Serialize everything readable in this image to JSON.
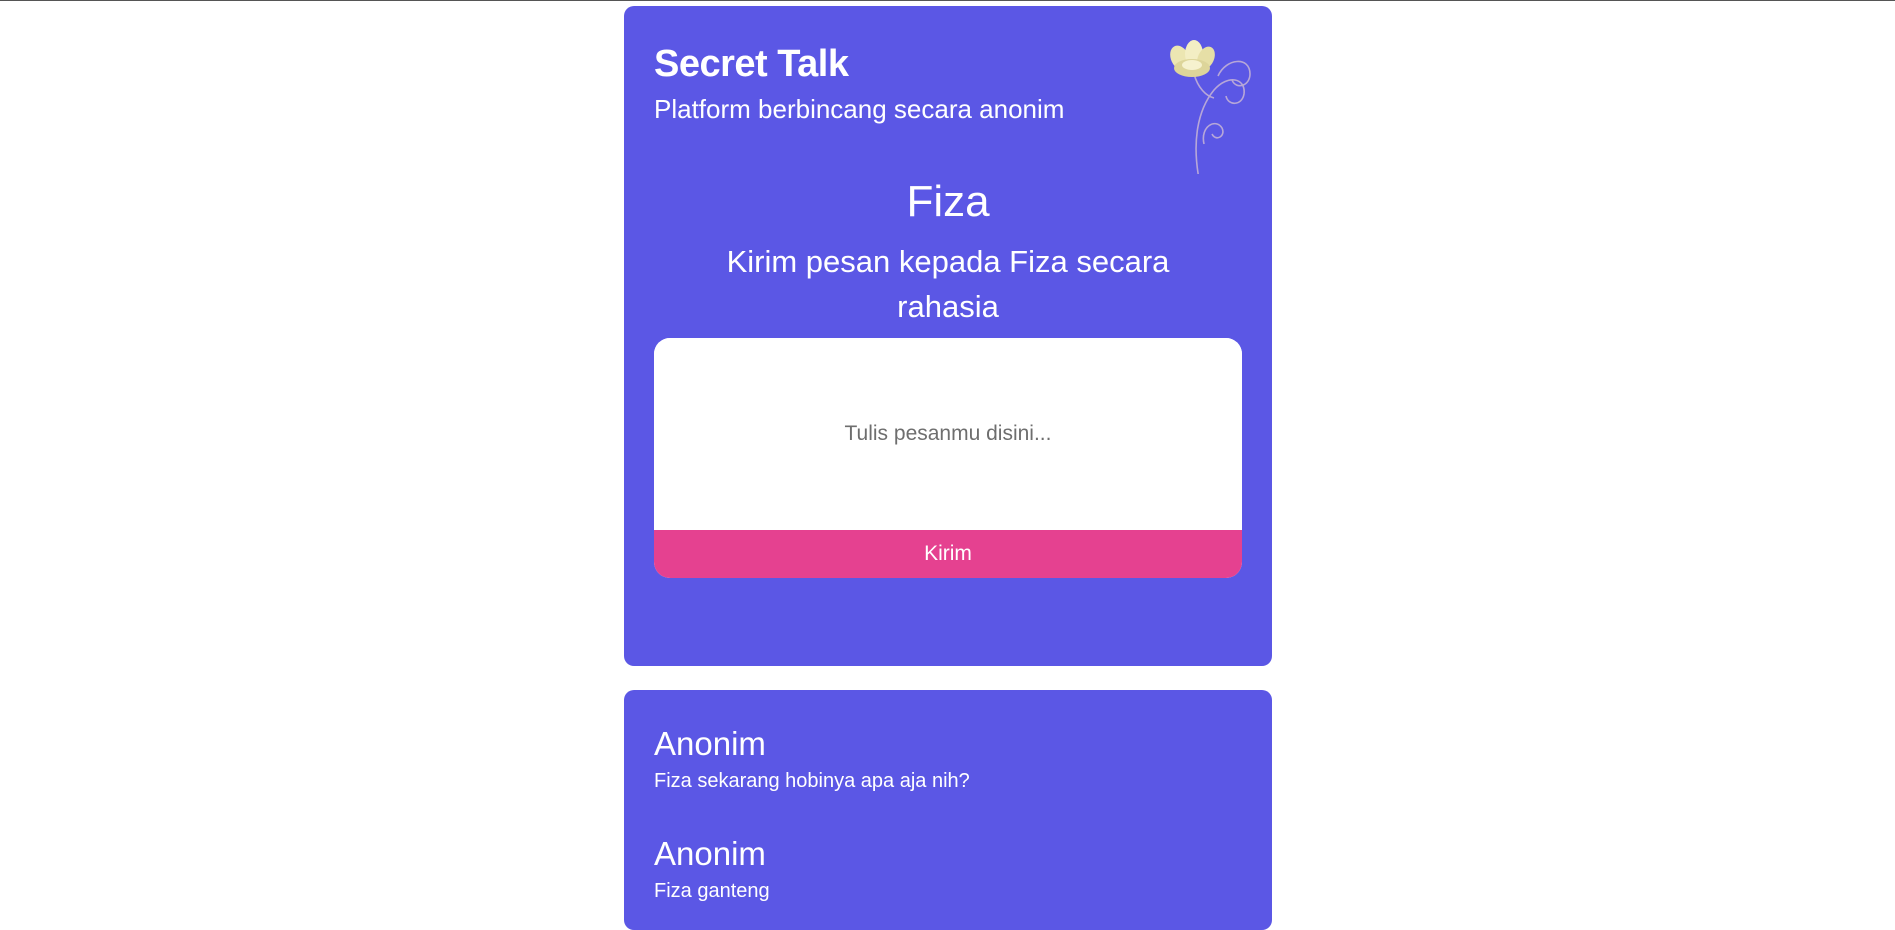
{
  "brand": {
    "title": "Secret Talk",
    "subtitle": "Platform berbincang secara anonim"
  },
  "recipient": {
    "name": "Fiza",
    "prompt": "Kirim pesan kepada Fiza secara rahasia"
  },
  "form": {
    "placeholder": "Tulis pesanmu disini...",
    "value": "",
    "submit_label": "Kirim"
  },
  "messages": [
    {
      "author": "Anonim",
      "text": "Fiza sekarang hobinya apa aja nih?"
    },
    {
      "author": "Anonim",
      "text": "Fiza ganteng"
    }
  ],
  "colors": {
    "card_bg": "#5b57e5",
    "button_bg": "#e54190",
    "text": "#ffffff",
    "page_bg": "#ffffff"
  },
  "icons": {
    "decoration": "flower-icon"
  }
}
